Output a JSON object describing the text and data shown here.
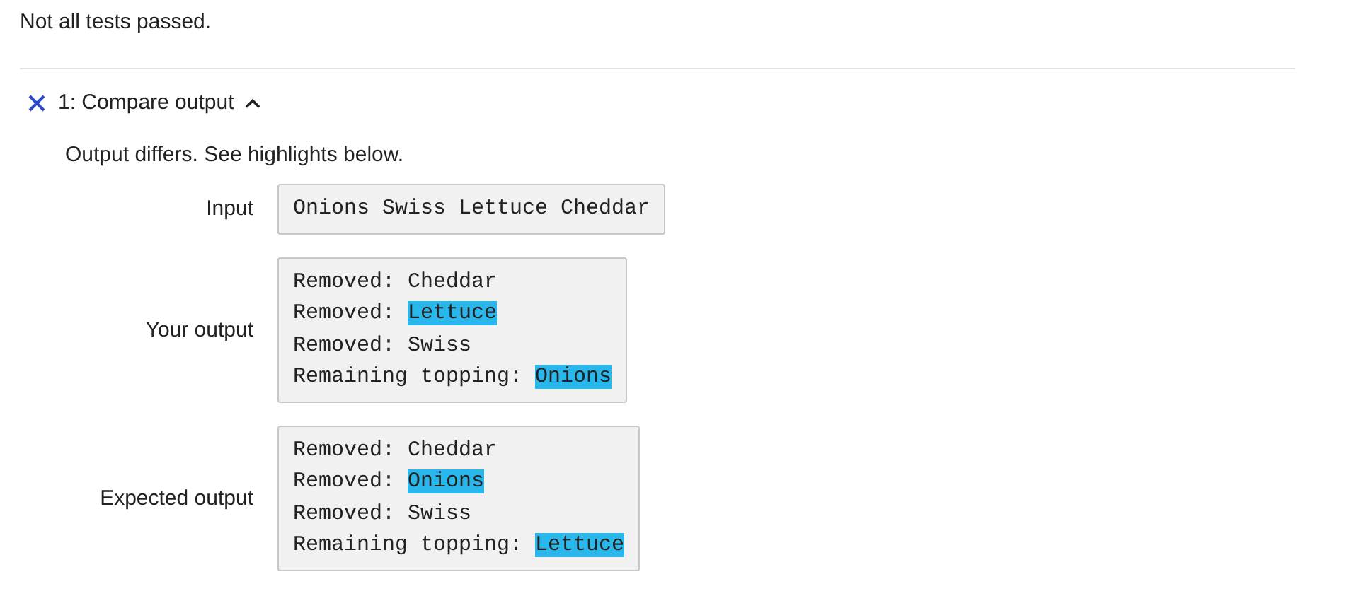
{
  "summary": "Not all tests passed.",
  "test": {
    "passed": false,
    "title": "1: Compare output",
    "expanded": true,
    "message": "Output differs. See highlights below.",
    "rows": [
      {
        "label": "Input",
        "lines": [
          [
            {
              "text": "Onions Swiss Lettuce Cheddar",
              "highlighted": false
            }
          ]
        ]
      },
      {
        "label": "Your output",
        "lines": [
          [
            {
              "text": "Removed: Cheddar",
              "highlighted": false
            }
          ],
          [
            {
              "text": "Removed: ",
              "highlighted": false
            },
            {
              "text": "Lettuce",
              "highlighted": true
            }
          ],
          [
            {
              "text": "Removed: Swiss",
              "highlighted": false
            }
          ],
          [
            {
              "text": "Remaining topping: ",
              "highlighted": false
            },
            {
              "text": "Onions",
              "highlighted": true
            }
          ]
        ]
      },
      {
        "label": "Expected output",
        "lines": [
          [
            {
              "text": "Removed: Cheddar",
              "highlighted": false
            }
          ],
          [
            {
              "text": "Removed: ",
              "highlighted": false
            },
            {
              "text": "Onions",
              "highlighted": true
            }
          ],
          [
            {
              "text": "Removed: Swiss",
              "highlighted": false
            }
          ],
          [
            {
              "text": "Remaining topping: ",
              "highlighted": false
            },
            {
              "text": "Lettuce",
              "highlighted": true
            }
          ]
        ]
      }
    ]
  }
}
